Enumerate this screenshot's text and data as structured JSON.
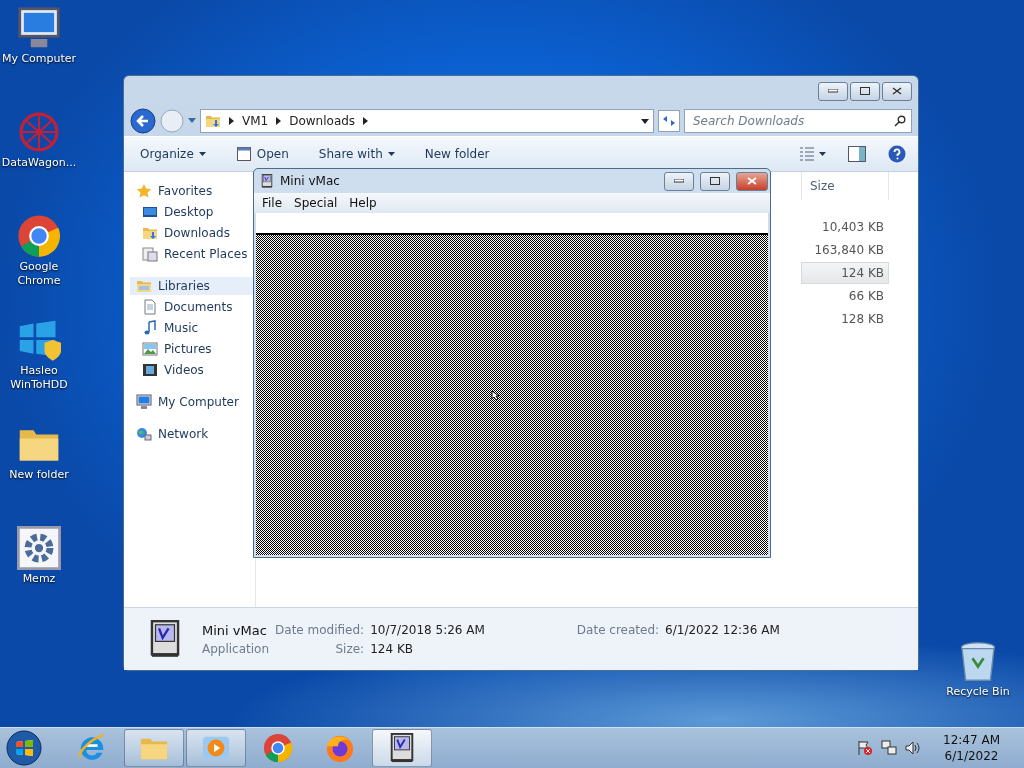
{
  "desktop_icons": [
    {
      "label": "My Computer",
      "kind": "computer"
    },
    {
      "label": "DataWagon...",
      "kind": "web"
    },
    {
      "label": "Google Chrome",
      "kind": "chrome"
    },
    {
      "label": "Hasleo WinToHDD",
      "kind": "windows"
    },
    {
      "label": "New folder",
      "kind": "folder"
    },
    {
      "label": "Memz",
      "kind": "gear"
    }
  ],
  "recycle_bin": {
    "label": "Recycle Bin"
  },
  "explorer": {
    "breadcrumb": [
      "VM1",
      "Downloads"
    ],
    "search": {
      "placeholder": "Search Downloads"
    },
    "toolbar": [
      {
        "label": "Organize",
        "kind": "menu"
      },
      {
        "label": "Open",
        "kind": "open"
      },
      {
        "label": "Share with",
        "kind": "menu"
      },
      {
        "label": "New folder",
        "kind": "plain"
      }
    ],
    "nav": [
      {
        "label": "Favorites",
        "kind": "star",
        "selected": false,
        "children": [
          {
            "label": "Desktop",
            "kind": "desktop"
          },
          {
            "label": "Downloads",
            "kind": "downloads"
          },
          {
            "label": "Recent Places",
            "kind": "recent"
          }
        ]
      },
      {
        "label": "Libraries",
        "kind": "library",
        "selected": true,
        "children": [
          {
            "label": "Documents",
            "kind": "document"
          },
          {
            "label": "Music",
            "kind": "music"
          },
          {
            "label": "Pictures",
            "kind": "pictures"
          },
          {
            "label": "Videos",
            "kind": "videos"
          }
        ]
      },
      {
        "label": "My Computer",
        "kind": "computer",
        "selected": false
      },
      {
        "label": "Network",
        "kind": "network",
        "selected": false
      }
    ],
    "columns": [
      "Size"
    ],
    "rows": [
      {
        "size": "10,403 KB",
        "selected": false
      },
      {
        "size": "163,840 KB",
        "selected": false
      },
      {
        "size": "124 KB",
        "selected": true
      },
      {
        "size": "66 KB",
        "selected": false
      },
      {
        "size": "128 KB",
        "selected": false
      }
    ],
    "details": {
      "name": "Mini vMac",
      "type": "Application",
      "fields": [
        {
          "label": "Date modified:",
          "value": "10/7/2018 5:26 AM"
        },
        {
          "label": "Date created:",
          "value": "6/1/2022 12:36 AM"
        },
        {
          "label": "Size:",
          "value": "124 KB"
        }
      ]
    }
  },
  "mini_vmac": {
    "title": "Mini vMac",
    "menu": [
      "File",
      "Special",
      "Help"
    ]
  },
  "taskbar": {
    "items": [
      {
        "kind": "ie",
        "running": false,
        "selected": false
      },
      {
        "kind": "explorer",
        "running": true,
        "selected": false
      },
      {
        "kind": "media",
        "running": true,
        "selected": false
      },
      {
        "kind": "chrome",
        "running": false,
        "selected": false
      },
      {
        "kind": "firefox",
        "running": false,
        "selected": false
      },
      {
        "kind": "vmac",
        "running": true,
        "selected": true
      }
    ],
    "clock": {
      "time": "12:47 AM",
      "date": "6/1/2022"
    }
  }
}
